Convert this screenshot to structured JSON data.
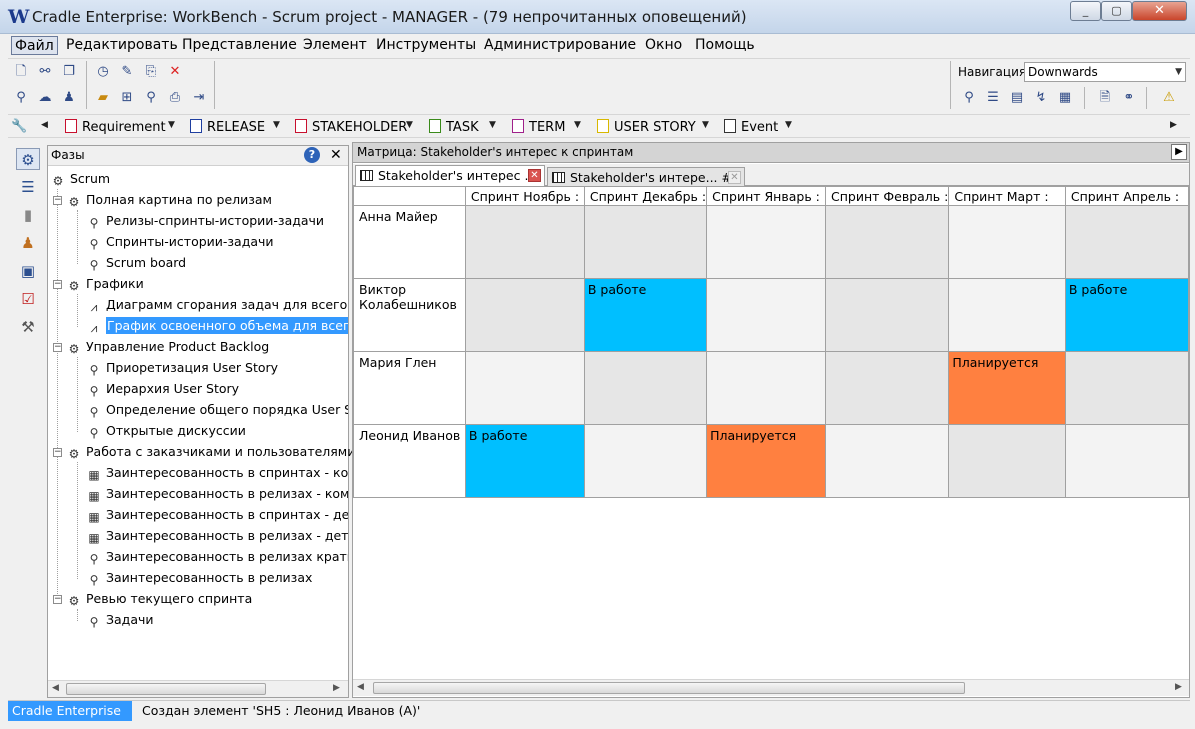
{
  "window": {
    "title": "Cradle Enterprise: WorkBench - Scrum project - MANAGER - (79 непрочитанных оповещений)",
    "min_label": "_",
    "max_label": "▢",
    "close_label": "✕"
  },
  "menu": {
    "items": [
      "Файл",
      "Редактировать",
      "Представление",
      "Элемент",
      "Инструменты",
      "Администрирование",
      "Окно",
      "Помощь"
    ]
  },
  "navigation": {
    "label": "Навигация",
    "value": "Downwards"
  },
  "type_bar": {
    "items": [
      {
        "label": "Requirement",
        "color": "#c8102e"
      },
      {
        "label": "RELEASE",
        "color": "#1f3fa0"
      },
      {
        "label": "STAKEHOLDER",
        "color": "#c8102e"
      },
      {
        "label": "TASK",
        "color": "#3a8a1a"
      },
      {
        "label": "TERM",
        "color": "#a0208a"
      },
      {
        "label": "USER STORY",
        "color": "#d8b800"
      },
      {
        "label": "Event",
        "color": "#333333"
      }
    ]
  },
  "tree": {
    "title": "Фазы",
    "help_label": "?",
    "close_label": "✕",
    "nodes": [
      {
        "label": "Scrum",
        "icon": "phases-icon"
      },
      {
        "label": "Полная картина по релизам",
        "icon": "phases-icon"
      },
      {
        "label": "Релизы-спринты-истории-задачи",
        "icon": "search-icon"
      },
      {
        "label": "Спринты-истории-задачи",
        "icon": "search-icon"
      },
      {
        "label": "Scrum board",
        "icon": "search-icon"
      },
      {
        "label": "Графики",
        "icon": "phases-icon"
      },
      {
        "label": "Диаграмм сгорания задач для всего backlog",
        "icon": "chart-icon"
      },
      {
        "label": "График освоенного объема для всего backlog",
        "icon": "chart-icon"
      },
      {
        "label": "Управление Product Backlog",
        "icon": "phases-icon"
      },
      {
        "label": "Приоретизация User Story",
        "icon": "search-icon"
      },
      {
        "label": "Иерархия User Story",
        "icon": "hierarchy-icon"
      },
      {
        "label": "Определение общего порядка User Story",
        "icon": "search-icon"
      },
      {
        "label": "Открытые дискуссии",
        "icon": "search-icon"
      },
      {
        "label": "Работа с заказчиками и пользователями",
        "icon": "phases-icon"
      },
      {
        "label": "Заинтересованность в спринтах - компактно",
        "icon": "matrix-icon"
      },
      {
        "label": "Заинтересованность в релизах - компактно",
        "icon": "matrix-icon"
      },
      {
        "label": "Заинтересованность в спринтах - детально",
        "icon": "matrix-icon"
      },
      {
        "label": "Заинтересованность в релизах - детально",
        "icon": "matrix-icon"
      },
      {
        "label": "Заинтересованность в релизах кратко",
        "icon": "search-icon"
      },
      {
        "label": "Заинтересованность в релизах",
        "icon": "search-icon"
      },
      {
        "label": "Ревью текущего спринта",
        "icon": "phases-icon"
      },
      {
        "label": "Задачи",
        "icon": "search-icon"
      }
    ]
  },
  "matrix": {
    "title": "Матрица: Stakeholder's интерес к спринтам",
    "tabs": [
      {
        "label": "Stakeholder's интерес ..."
      },
      {
        "label": "Stakeholder's интере... #1"
      }
    ],
    "columns": [
      "Спринт Ноябрь :",
      "Спринт Декабрь :",
      "Спринт Январь :",
      "Спринт Февраль :",
      "Спринт Март :",
      "Спринт Апрель :"
    ],
    "rows": [
      {
        "name": "Анна Майер",
        "cells": [
          "",
          "",
          "",
          "",
          "",
          ""
        ]
      },
      {
        "name": "Виктор Колабешников",
        "cells": [
          "",
          "В работе",
          "",
          "",
          "",
          "В работе"
        ]
      },
      {
        "name": "Мария Глен",
        "cells": [
          "",
          "",
          "",
          "",
          "Планируется",
          ""
        ]
      },
      {
        "name": "Леонид Иванов",
        "cells": [
          "В работе",
          "",
          "Планируется",
          "",
          "",
          ""
        ]
      }
    ],
    "status_colors": {
      "В работе": "#00bfff",
      "Планируется": "#ff8040"
    }
  },
  "status": {
    "app": "Cradle Enterprise",
    "message": "Создан элемент 'SH5 : Леонид Иванов (A)'"
  }
}
